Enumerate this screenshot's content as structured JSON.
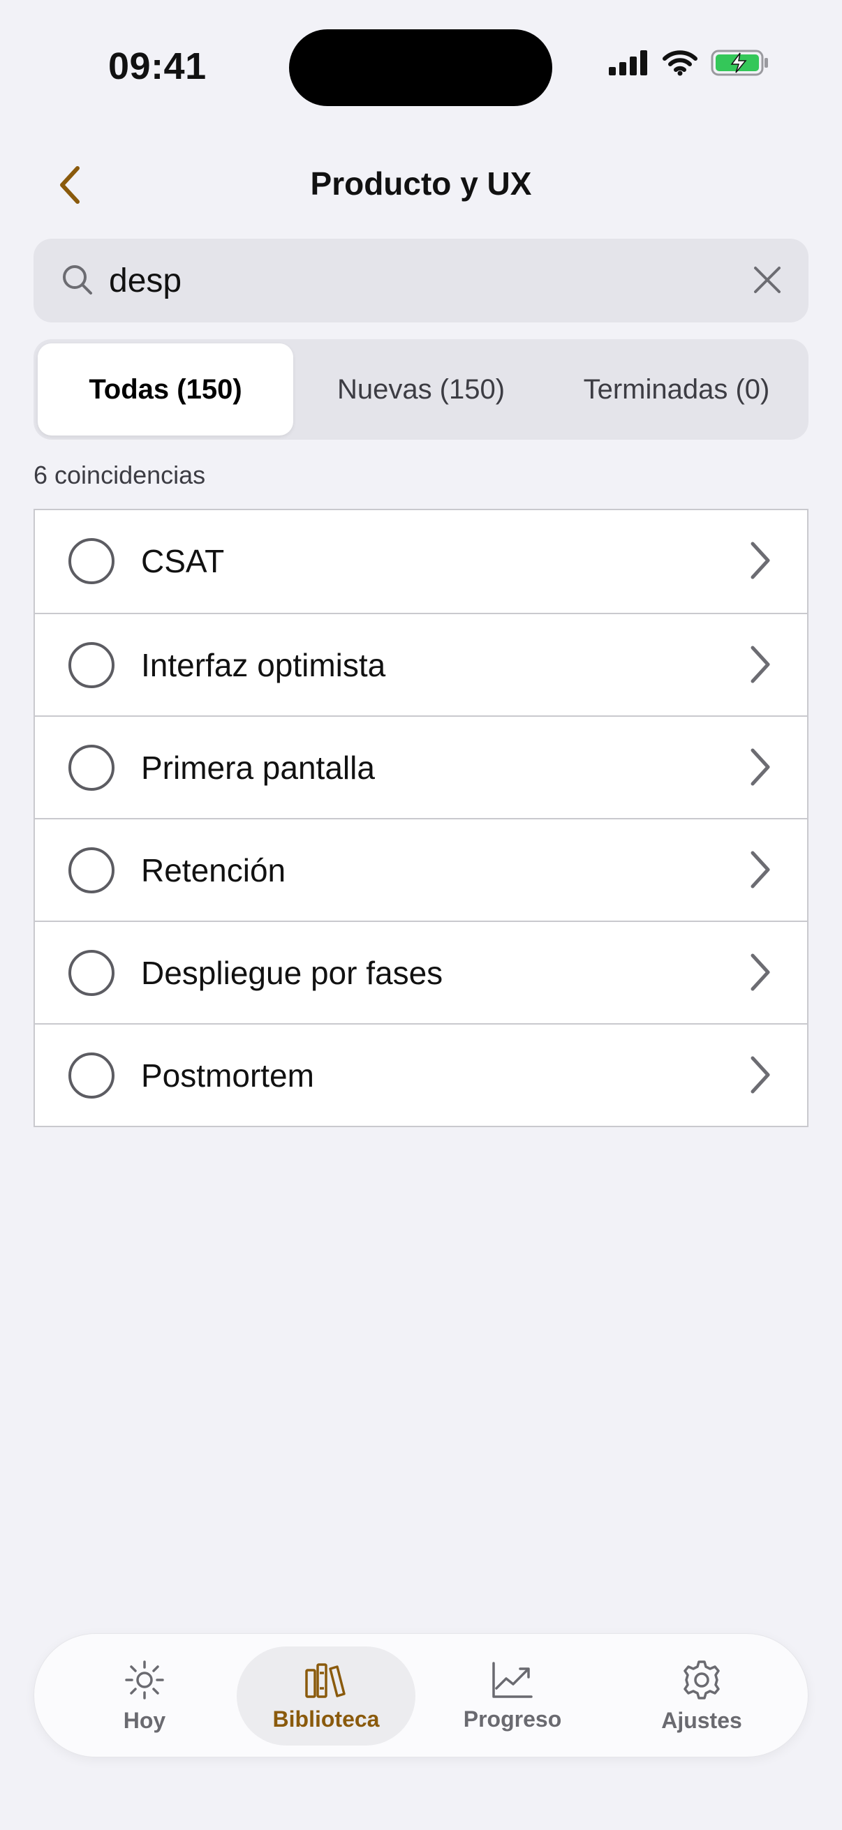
{
  "status_bar": {
    "time": "09:41"
  },
  "nav": {
    "title": "Producto y UX",
    "back_icon": "chevron-left-icon",
    "accent_color": "#8a5a0c"
  },
  "search": {
    "value": "desp",
    "placeholder": "Buscar"
  },
  "segments": [
    {
      "label": "Todas (150)",
      "selected": true
    },
    {
      "label": "Nuevas (150)",
      "selected": false
    },
    {
      "label": "Terminadas (0)",
      "selected": false
    }
  ],
  "match_count": "6 coincidencias",
  "items": [
    {
      "label": "CSAT"
    },
    {
      "label": "Interfaz optimista"
    },
    {
      "label": "Primera pantalla"
    },
    {
      "label": "Retención"
    },
    {
      "label": "Despliegue por fases"
    },
    {
      "label": "Postmortem"
    }
  ],
  "tabbar": {
    "tabs": [
      {
        "label": "Hoy",
        "icon": "sun-icon",
        "active": false
      },
      {
        "label": "Biblioteca",
        "icon": "books-icon",
        "active": true
      },
      {
        "label": "Progreso",
        "icon": "chart-icon",
        "active": false
      },
      {
        "label": "Ajustes",
        "icon": "gear-icon",
        "active": false
      }
    ]
  }
}
